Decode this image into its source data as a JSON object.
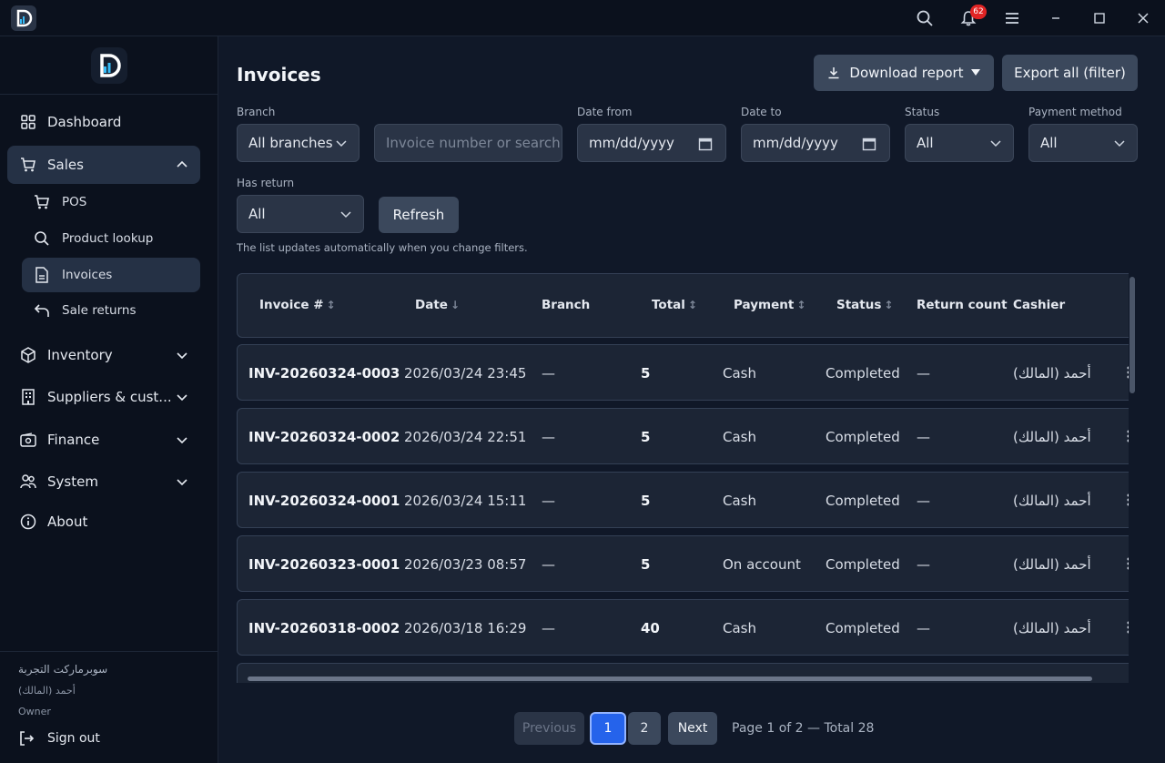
{
  "titlebar": {
    "notification_count": "62"
  },
  "sidebar": {
    "items": [
      {
        "label": "Dashboard",
        "icon": "grid-icon"
      },
      {
        "label": "Sales",
        "icon": "cart-icon"
      },
      {
        "label": "POS",
        "icon": "cart-icon"
      },
      {
        "label": "Product lookup",
        "icon": "search-icon"
      },
      {
        "label": "Invoices",
        "icon": "document-icon"
      },
      {
        "label": "Sale returns",
        "icon": "undo-icon"
      },
      {
        "label": "Inventory",
        "icon": "box-icon"
      },
      {
        "label": "Suppliers & cust...",
        "icon": "building-icon"
      },
      {
        "label": "Finance",
        "icon": "wallet-icon"
      },
      {
        "label": "System",
        "icon": "users-icon"
      },
      {
        "label": "About",
        "icon": "info-icon"
      }
    ],
    "footer": {
      "store_name": "سوبرماركت التجربة",
      "user_name": "أحمد (المالك)",
      "role": "Owner",
      "sign_out": "Sign out"
    }
  },
  "page": {
    "title": "Invoices",
    "download_report": "Download report",
    "export_all": "Export all (filter)"
  },
  "filters": {
    "branch_label": "Branch",
    "branch_value": "All branches",
    "search_placeholder": "Invoice number or search",
    "date_from_label": "Date from",
    "date_from_value": "mm/dd/yyyy",
    "date_to_label": "Date to",
    "date_to_value": "mm/dd/yyyy",
    "status_label": "Status",
    "status_value": "All",
    "payment_label": "Payment method",
    "payment_value": "All",
    "has_return_label": "Has return",
    "has_return_value": "All",
    "refresh": "Refresh",
    "hint": "The list updates automatically when you change filters."
  },
  "table": {
    "columns": [
      "Invoice #",
      "Date",
      "Branch",
      "Total",
      "Payment",
      "Status",
      "Return count",
      "Cashier"
    ],
    "rows": [
      {
        "invoice": "INV-20260324-0003",
        "date": "2026/03/24 23:45",
        "branch": "—",
        "total": "5",
        "payment": "Cash",
        "status": "Completed",
        "returns": "—",
        "cashier": "أحمد (المالك)"
      },
      {
        "invoice": "INV-20260324-0002",
        "date": "2026/03/24 22:51",
        "branch": "—",
        "total": "5",
        "payment": "Cash",
        "status": "Completed",
        "returns": "—",
        "cashier": "أحمد (المالك)"
      },
      {
        "invoice": "INV-20260324-0001",
        "date": "2026/03/24 15:11",
        "branch": "—",
        "total": "5",
        "payment": "Cash",
        "status": "Completed",
        "returns": "—",
        "cashier": "أحمد (المالك)"
      },
      {
        "invoice": "INV-20260323-0001",
        "date": "2026/03/23 08:57",
        "branch": "—",
        "total": "5",
        "payment": "On account",
        "status": "Completed",
        "returns": "—",
        "cashier": "أحمد (المالك)"
      },
      {
        "invoice": "INV-20260318-0002",
        "date": "2026/03/18 16:29",
        "branch": "—",
        "total": "40",
        "payment": "Cash",
        "status": "Completed",
        "returns": "—",
        "cashier": "أحمد (المالك)"
      }
    ]
  },
  "pagination": {
    "previous": "Previous",
    "page1": "1",
    "page2": "2",
    "next": "Next",
    "info": "Page 1 of 2 — Total 28"
  },
  "colors": {
    "accent": "#2563eb",
    "badge": "#e02424",
    "background": "#101828"
  }
}
